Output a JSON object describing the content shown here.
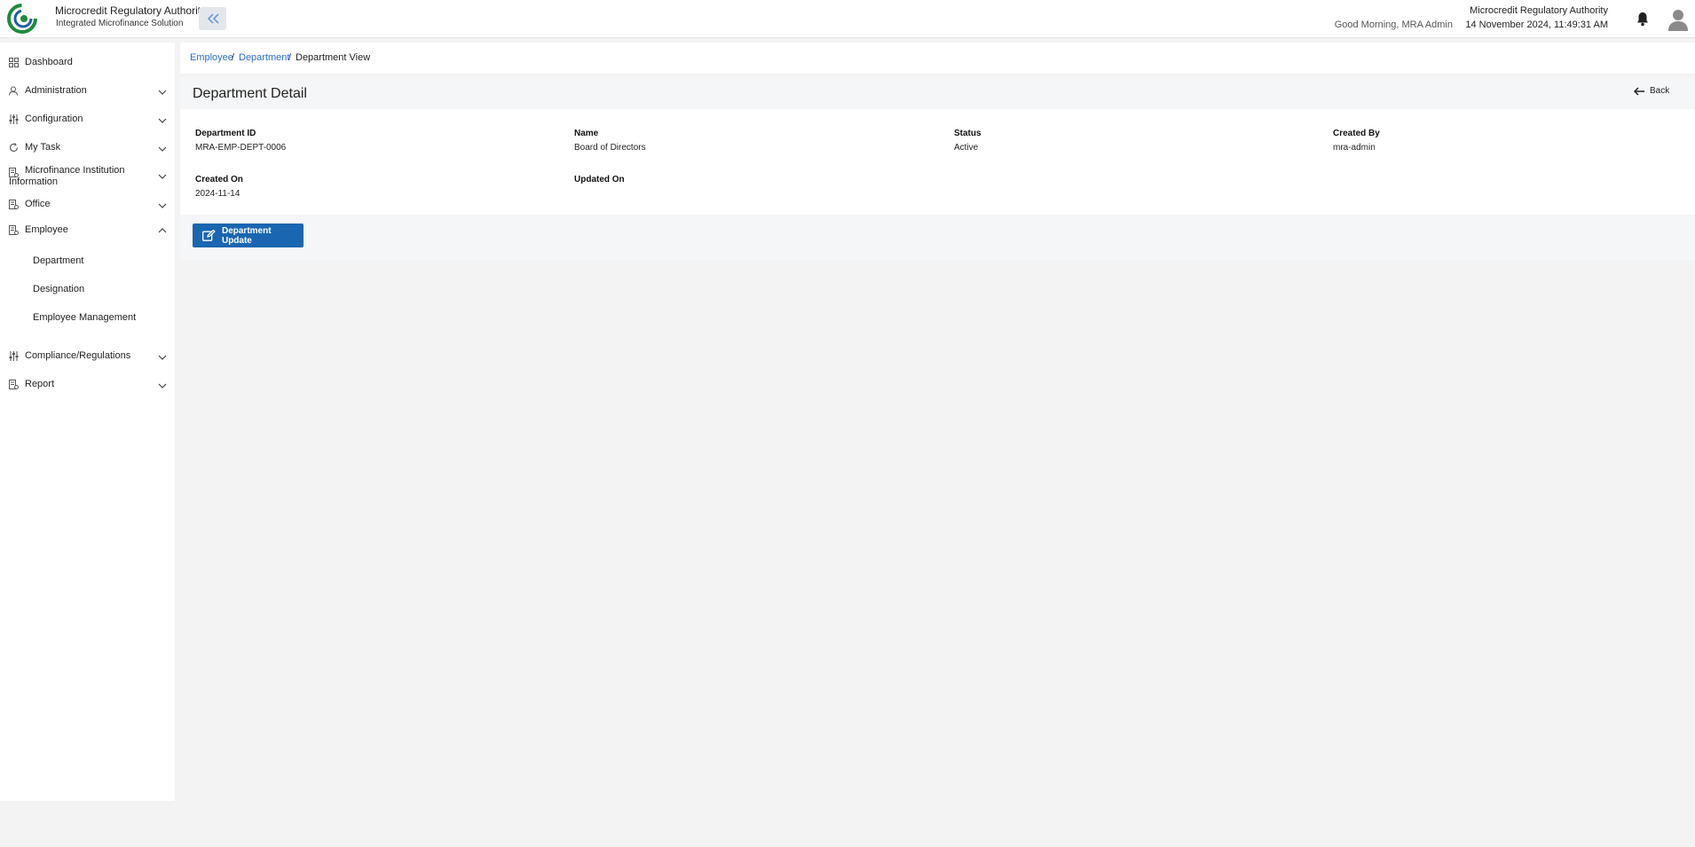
{
  "header": {
    "logo_text": "Microcredit Regulatory Authority",
    "brand_title": "Microcredit Regulatory Authority",
    "brand_subtitle": "Integrated Microfinance Solution",
    "greeting": "Good Morning, MRA Admin",
    "org_name": "Microcredit Regulatory Authority",
    "datetime": "14 November 2024, 11:49:31 AM"
  },
  "sidebar": {
    "items": [
      {
        "label": "Dashboard",
        "icon": "dashboard-icon"
      },
      {
        "label": "Administration",
        "icon": "admin-icon"
      },
      {
        "label": "Configuration",
        "icon": "config-icon"
      },
      {
        "label": "My Task",
        "icon": "task-icon"
      },
      {
        "label": "Microfinance Institution Information",
        "icon": "institution-icon"
      },
      {
        "label": "Office",
        "icon": "office-icon"
      },
      {
        "label": "Employee",
        "icon": "employee-icon"
      },
      {
        "label": "Compliance/Regulations",
        "icon": "compliance-icon"
      },
      {
        "label": "Report",
        "icon": "report-icon"
      }
    ],
    "employee_subitems": [
      "Department",
      "Designation",
      "Employee Management"
    ]
  },
  "breadcrumb": {
    "items": [
      "Employee",
      "Department",
      "Department View"
    ]
  },
  "detail": {
    "title": "Department Detail",
    "back_label": "Back",
    "fields": [
      {
        "label": "Department ID",
        "value": "MRA-EMP-DEPT-0006"
      },
      {
        "label": "Name",
        "value": "Board of Directors"
      },
      {
        "label": "Status",
        "value": "Active"
      },
      {
        "label": "Created By",
        "value": "mra-admin"
      },
      {
        "label": "Created On",
        "value": "2024-11-14"
      },
      {
        "label": "Updated On",
        "value": ""
      }
    ],
    "update_button_label": "Department Update"
  },
  "colors": {
    "accent": "#1a66b0",
    "link": "#2b6fd1",
    "logo_green": "#1f8a3b"
  }
}
